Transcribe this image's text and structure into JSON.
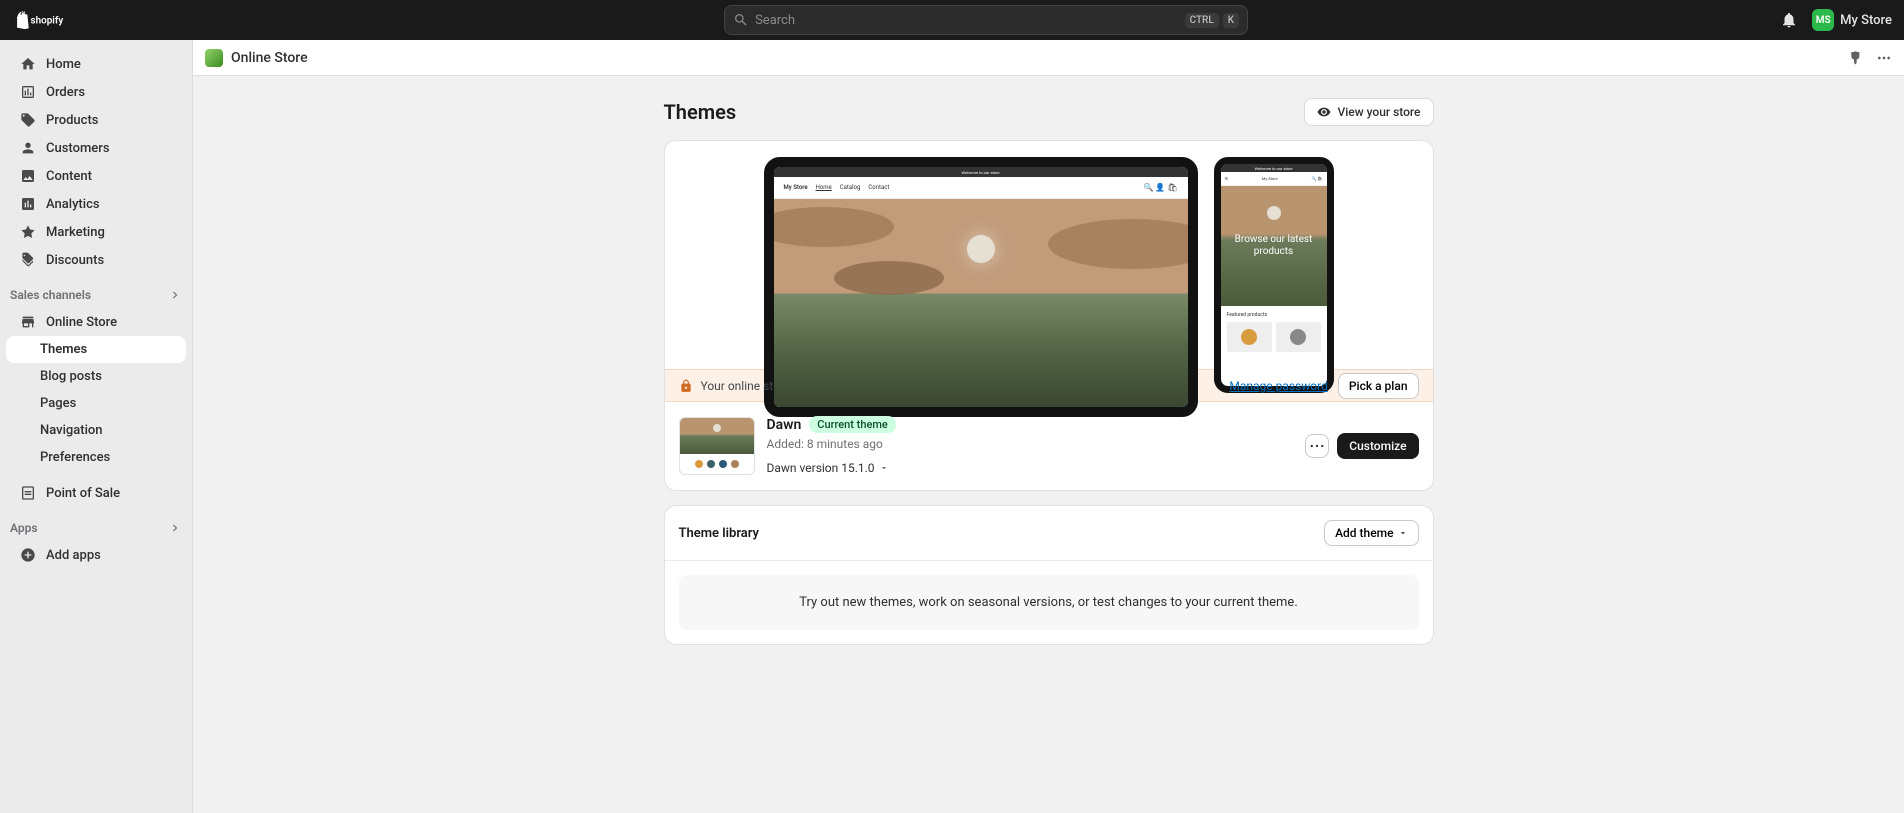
{
  "header": {
    "search_placeholder": "Search",
    "shortcut_key1": "CTRL",
    "shortcut_key2": "K",
    "store_name": "My Store",
    "store_initials": "MS"
  },
  "sidebar": {
    "items": [
      {
        "label": "Home"
      },
      {
        "label": "Orders"
      },
      {
        "label": "Products"
      },
      {
        "label": "Customers"
      },
      {
        "label": "Content"
      },
      {
        "label": "Analytics"
      },
      {
        "label": "Marketing"
      },
      {
        "label": "Discounts"
      }
    ],
    "sales_channels_label": "Sales channels",
    "online_store_label": "Online Store",
    "online_store_sub": [
      {
        "label": "Themes",
        "active": true
      },
      {
        "label": "Blog posts"
      },
      {
        "label": "Pages"
      },
      {
        "label": "Navigation"
      },
      {
        "label": "Preferences"
      }
    ],
    "pos_label": "Point of Sale",
    "apps_label": "Apps",
    "add_apps_label": "Add apps"
  },
  "sec_header": {
    "title": "Online Store"
  },
  "page": {
    "title": "Themes",
    "view_store": "View your store"
  },
  "preview": {
    "announcement": "Welcome to our store",
    "brand": "My Store",
    "nav_home": "Home",
    "nav_catalog": "Catalog",
    "nav_contact": "Contact",
    "mobile_browse": "Browse our latest products",
    "mobile_featured": "Featured products"
  },
  "banner": {
    "text": "Your online store is password protected. To remove the password, pick a plan.",
    "manage": "Manage password",
    "pick_plan": "Pick a plan"
  },
  "theme": {
    "name": "Dawn",
    "badge": "Current theme",
    "added": "Added: 8 minutes ago",
    "version": "Dawn version 15.1.0",
    "customize": "Customize"
  },
  "library": {
    "title": "Theme library",
    "add_theme": "Add theme",
    "empty_text": "Try out new themes, work on seasonal versions, or test changes to your current theme."
  }
}
